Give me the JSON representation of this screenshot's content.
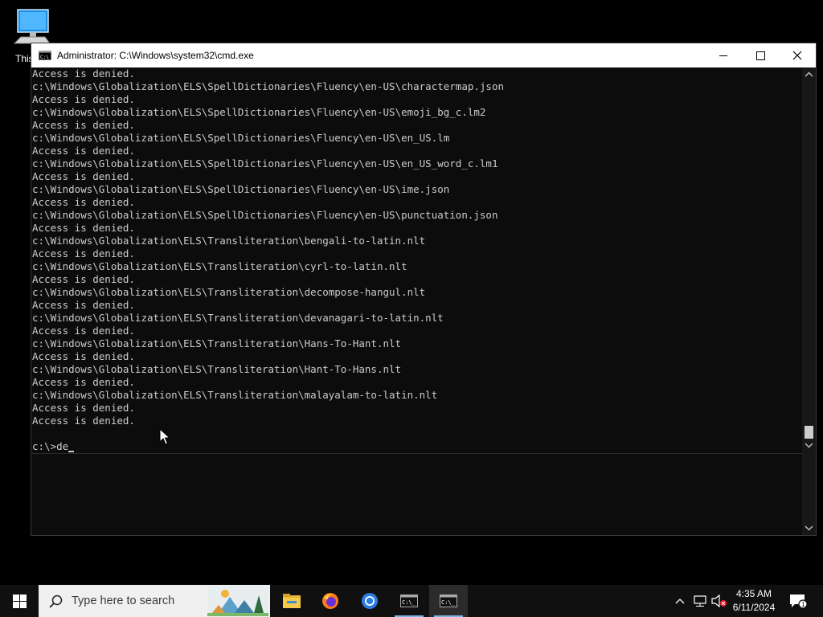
{
  "desktop": {
    "icon_label": "This"
  },
  "window": {
    "title": "Administrator: C:\\Windows\\system32\\cmd.exe",
    "icons": {
      "app": "cmd-icon",
      "minimize": "minimize-icon",
      "maximize": "maximize-icon",
      "close": "close-icon"
    }
  },
  "console": {
    "lines": [
      "Access is denied.",
      "c:\\Windows\\Globalization\\ELS\\SpellDictionaries\\Fluency\\en-US\\charactermap.json",
      "Access is denied.",
      "c:\\Windows\\Globalization\\ELS\\SpellDictionaries\\Fluency\\en-US\\emoji_bg_c.lm2",
      "Access is denied.",
      "c:\\Windows\\Globalization\\ELS\\SpellDictionaries\\Fluency\\en-US\\en_US.lm",
      "Access is denied.",
      "c:\\Windows\\Globalization\\ELS\\SpellDictionaries\\Fluency\\en-US\\en_US_word_c.lm1",
      "Access is denied.",
      "c:\\Windows\\Globalization\\ELS\\SpellDictionaries\\Fluency\\en-US\\ime.json",
      "Access is denied.",
      "c:\\Windows\\Globalization\\ELS\\SpellDictionaries\\Fluency\\en-US\\punctuation.json",
      "Access is denied.",
      "c:\\Windows\\Globalization\\ELS\\Transliteration\\bengali-to-latin.nlt",
      "Access is denied.",
      "c:\\Windows\\Globalization\\ELS\\Transliteration\\cyrl-to-latin.nlt",
      "Access is denied.",
      "c:\\Windows\\Globalization\\ELS\\Transliteration\\decompose-hangul.nlt",
      "Access is denied.",
      "c:\\Windows\\Globalization\\ELS\\Transliteration\\devanagari-to-latin.nlt",
      "Access is denied.",
      "c:\\Windows\\Globalization\\ELS\\Transliteration\\Hans-To-Hant.nlt",
      "Access is denied.",
      "c:\\Windows\\Globalization\\ELS\\Transliteration\\Hant-To-Hans.nlt",
      "Access is denied.",
      "c:\\Windows\\Globalization\\ELS\\Transliteration\\malayalam-to-latin.nlt",
      "Access is denied.",
      "Access is denied.",
      ""
    ],
    "prompt": "c:\\>de"
  },
  "taskbar": {
    "search_placeholder": "Type here to search",
    "apps": [
      "file-explorer-icon",
      "firefox-icon",
      "chrome-icon",
      "terminal-icon",
      "cmd-icon"
    ],
    "tray_icons": [
      "chevron-up-icon",
      "network-icon",
      "speaker-muted-icon",
      "notification-icon"
    ],
    "notification_count": "1",
    "time": "4:35 AM",
    "date": "6/11/2024"
  }
}
